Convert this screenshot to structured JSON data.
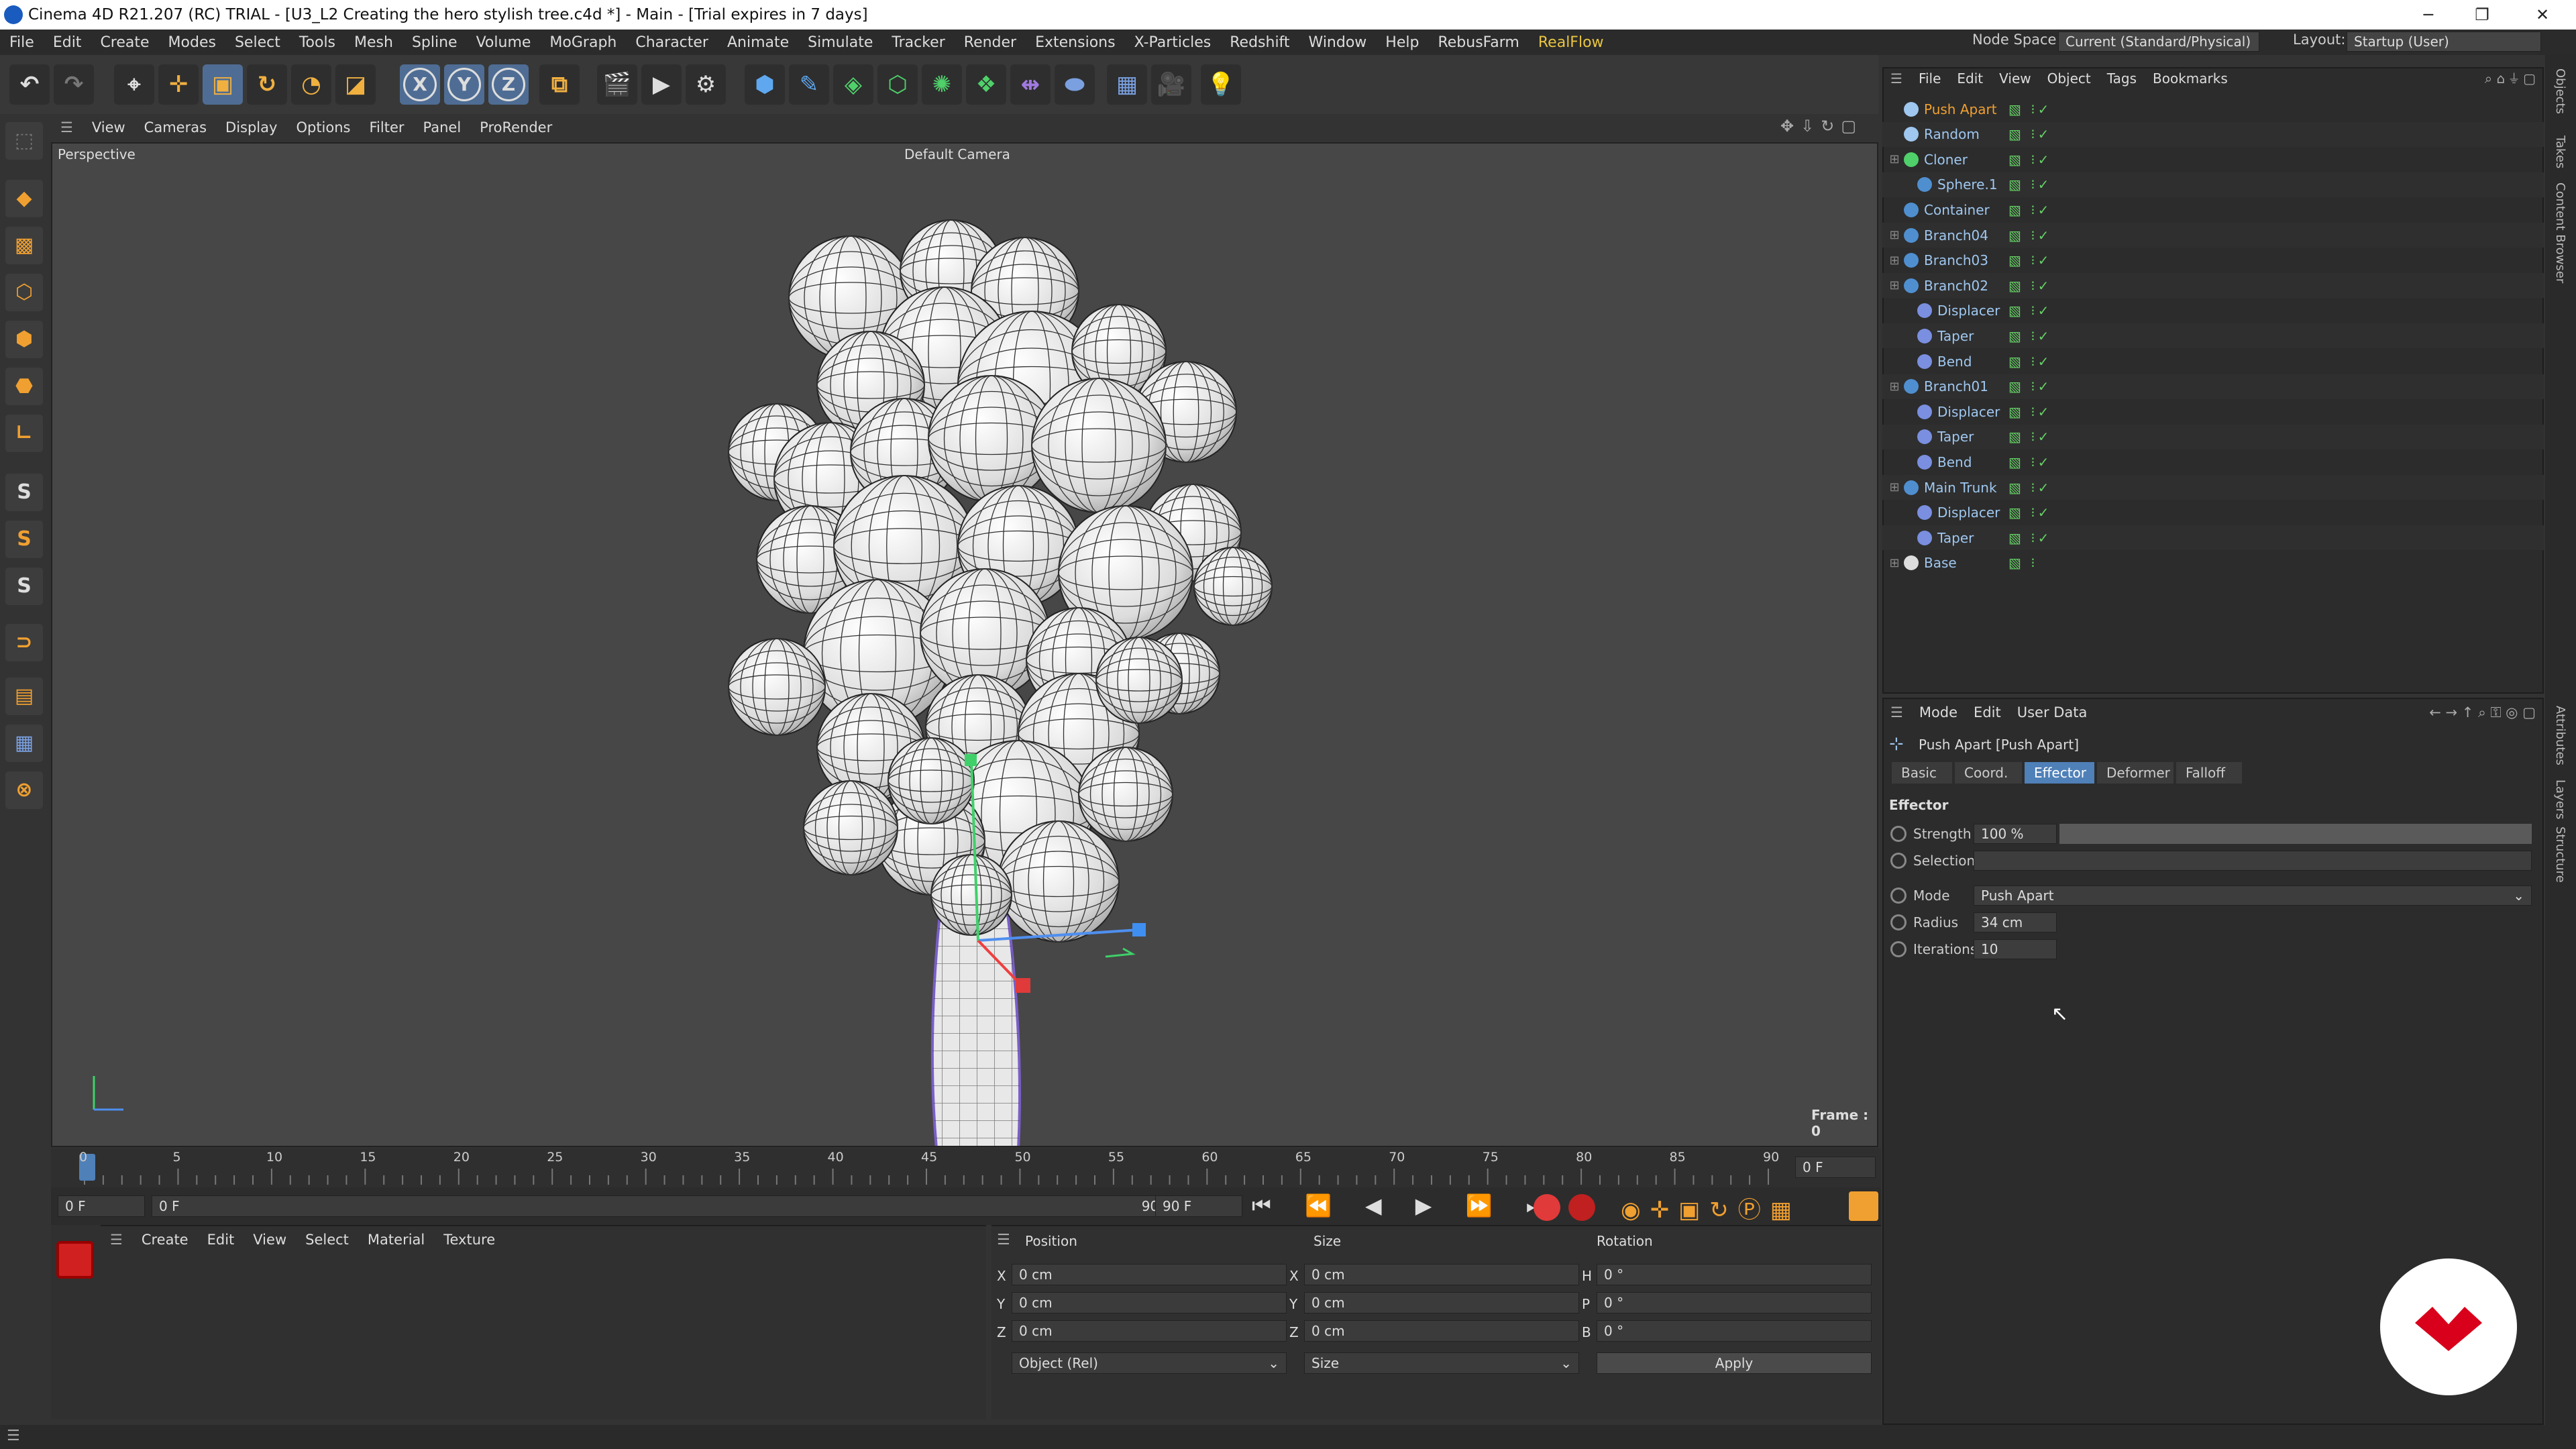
{
  "window": {
    "title": "Cinema 4D R21.207 (RC) TRIAL - [U3_L2 Creating the hero stylish tree.c4d *] - Main - [Trial expires in 7 days]"
  },
  "menubar": {
    "items": [
      "File",
      "Edit",
      "Create",
      "Modes",
      "Select",
      "Tools",
      "Mesh",
      "Spline",
      "Volume",
      "MoGraph",
      "Character",
      "Animate",
      "Simulate",
      "Tracker",
      "Render",
      "Extensions",
      "X-Particles",
      "Redshift",
      "Window",
      "Help",
      "RebusFarm",
      "RealFlow"
    ],
    "node_space_label": "Node Space:",
    "node_space_value": "Current (Standard/Physical)",
    "layout_label": "Layout:",
    "layout_value": "Startup (User)"
  },
  "viewport": {
    "menu": [
      "View",
      "Cameras",
      "Display",
      "Options",
      "Filter",
      "Panel",
      "ProRender"
    ],
    "view_name": "Perspective",
    "camera": "Default Camera",
    "frame": "Frame : 0"
  },
  "timeline": {
    "ticks": [
      "0",
      "5",
      "10",
      "15",
      "20",
      "25",
      "30",
      "35",
      "40",
      "45",
      "50",
      "55",
      "60",
      "65",
      "70",
      "75",
      "80",
      "85",
      "90"
    ],
    "current": "0 F"
  },
  "playbar": {
    "start": "0 F",
    "range_start": "0 F",
    "range_end": "90 F",
    "end": "90 F"
  },
  "material_panel": {
    "menu": [
      "Create",
      "Edit",
      "View",
      "Select",
      "Material",
      "Texture"
    ]
  },
  "coord_panel": {
    "headers": [
      "Position",
      "Size",
      "Rotation"
    ],
    "rows": [
      {
        "axis": "X",
        "pos": "0 cm",
        "size_axis": "X",
        "size": "0 cm",
        "rot_axis": "H",
        "rot": "0 °"
      },
      {
        "axis": "Y",
        "pos": "0 cm",
        "size_axis": "Y",
        "size": "0 cm",
        "rot_axis": "P",
        "rot": "0 °"
      },
      {
        "axis": "Z",
        "pos": "0 cm",
        "size_axis": "Z",
        "size": "0 cm",
        "rot_axis": "B",
        "rot": "0 °"
      }
    ],
    "mode": "Object (Rel)",
    "size_mode": "Size",
    "apply": "Apply"
  },
  "object_manager": {
    "menu": [
      "File",
      "Edit",
      "View",
      "Object",
      "Tags",
      "Bookmarks"
    ],
    "objects": [
      {
        "name": "Push Apart",
        "indent": 0
      },
      {
        "name": "Random",
        "indent": 0
      },
      {
        "name": "Cloner",
        "indent": 0
      },
      {
        "name": "Sphere.1",
        "indent": 1
      },
      {
        "name": "Container",
        "indent": 0
      },
      {
        "name": "Branch04",
        "indent": 0
      },
      {
        "name": "Branch03",
        "indent": 0
      },
      {
        "name": "Branch02",
        "indent": 0
      },
      {
        "name": "Displacer",
        "indent": 1
      },
      {
        "name": "Taper",
        "indent": 1
      },
      {
        "name": "Bend",
        "indent": 1
      },
      {
        "name": "Branch01",
        "indent": 0
      },
      {
        "name": "Displacer",
        "indent": 1
      },
      {
        "name": "Taper",
        "indent": 1
      },
      {
        "name": "Bend",
        "indent": 1
      },
      {
        "name": "Main Trunk",
        "indent": 0
      },
      {
        "name": "Displacer",
        "indent": 1
      },
      {
        "name": "Taper",
        "indent": 1
      },
      {
        "name": "Base",
        "indent": 0
      }
    ]
  },
  "attributes": {
    "menu": [
      "Mode",
      "Edit",
      "User Data"
    ],
    "object_title": "Push Apart [Push Apart]",
    "tabs": [
      "Basic",
      "Coord.",
      "Effector",
      "Deformer",
      "Falloff"
    ],
    "section": "Effector",
    "strength_label": "Strength",
    "strength_value": "100 %",
    "strength_fraction": 1.0,
    "selection_label": "Selection",
    "mode_label": "Mode",
    "mode_value": "Push Apart",
    "radius_label": "Radius",
    "radius_value": "34 cm",
    "iterations_label": "Iterations",
    "iterations_value": "10"
  },
  "side_tabs": [
    "Objects",
    "Takes",
    "Content Browser",
    "Attributes",
    "Layers",
    "Structure"
  ],
  "colors": {
    "accent": "#4f80b8",
    "highlight": "#f0a030",
    "brand_logo": "#d9001b"
  }
}
